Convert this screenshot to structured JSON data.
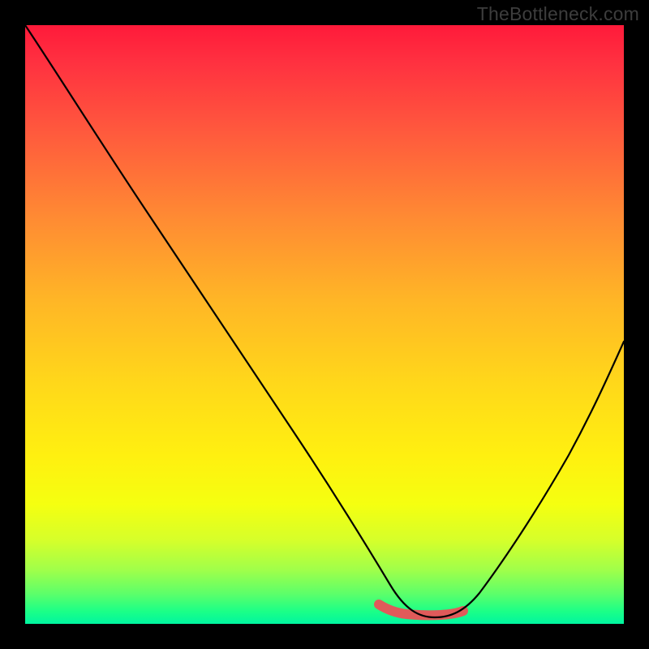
{
  "watermark": "TheBottleneck.com",
  "chart_data": {
    "type": "line",
    "title": "",
    "xlabel": "",
    "ylabel": "",
    "xlim": [
      0,
      100
    ],
    "ylim": [
      0,
      100
    ],
    "grid": false,
    "legend": false,
    "colors": {
      "gradient_top": "#ff1a3a",
      "gradient_bottom": "#00f5a0",
      "line": "#000000",
      "highlight": "#e05a5a",
      "frame": "#000000"
    },
    "series": [
      {
        "name": "bottleneck-curve",
        "x": [
          0,
          5,
          12,
          20,
          28,
          36,
          44,
          52,
          58,
          62,
          65,
          68,
          71,
          74,
          78,
          82,
          86,
          90,
          94,
          98,
          100
        ],
        "values": [
          100,
          92,
          83,
          72,
          61,
          50,
          39,
          27,
          17,
          10,
          5,
          2,
          1,
          1,
          2,
          5,
          11,
          19,
          29,
          41,
          48
        ]
      }
    ],
    "highlight_range": {
      "x_start": 60,
      "x_end": 73,
      "note": "optimal zone"
    }
  }
}
